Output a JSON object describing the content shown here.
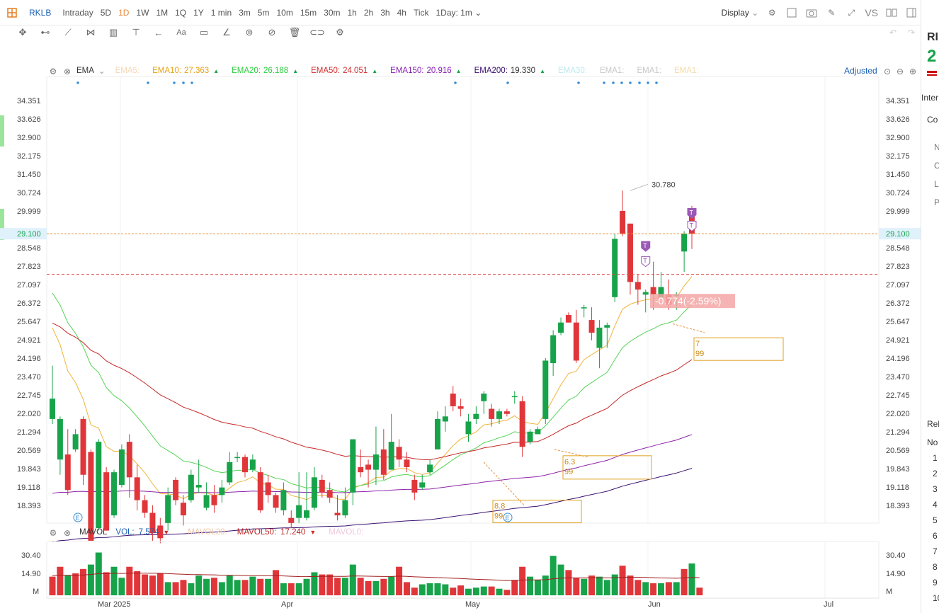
{
  "topbar": {
    "symbol": "RKLB",
    "timeframes": [
      "Intraday",
      "5D",
      "1D",
      "1W",
      "1M",
      "1Q",
      "1Y",
      "1 min",
      "3m",
      "5m",
      "10m",
      "15m",
      "30m",
      "1h",
      "2h",
      "3h",
      "4h",
      "Tick"
    ],
    "active_timeframe": "1D",
    "interval_select": "1Day: 1m",
    "display_label": "Display",
    "vs_label": "VS"
  },
  "ema_legend": {
    "label": "EMA",
    "items": [
      {
        "name": "EMA5:",
        "value": "",
        "color": "#f5d6b8"
      },
      {
        "name": "EMA10:",
        "value": "27.363",
        "color": "#e8a317"
      },
      {
        "name": "EMA20:",
        "value": "26.188",
        "color": "#2ecc40"
      },
      {
        "name": "EMA50:",
        "value": "24.051",
        "color": "#d12b2b"
      },
      {
        "name": "EMA150:",
        "value": "20.916",
        "color": "#8a1fb4"
      },
      {
        "name": "EMA200:",
        "value": "19.330",
        "color": "#3a1070"
      },
      {
        "name": "EMA30:",
        "value": "",
        "color": "#bfe8ee"
      },
      {
        "name": "EMA1:",
        "value": "",
        "color": "#c8c8c8"
      },
      {
        "name": "EMA1:",
        "value": "",
        "color": "#c8c8c8"
      },
      {
        "name": "EMA1:",
        "value": "",
        "color": "#f3dca8"
      }
    ],
    "adjusted_label": "Adjusted"
  },
  "price_axis": {
    "labels": [
      "34.351",
      "33.626",
      "32.900",
      "32.175",
      "31.450",
      "30.724",
      "29.999",
      "29.100",
      "28.548",
      "27.823",
      "27.097",
      "26.372",
      "25.647",
      "24.921",
      "24.196",
      "23.470",
      "22.745",
      "22.020",
      "21.294",
      "20.569",
      "19.843",
      "19.118",
      "18.393"
    ],
    "current_price": "29.100",
    "high_label": "30.780",
    "change_label": "-0.774(-2.59%)"
  },
  "annotations": [
    {
      "line1": "7",
      "line2": "99"
    },
    {
      "line1": "6.3",
      "line2": "99"
    },
    {
      "line1": "8.8",
      "line2": "99"
    }
  ],
  "volume_legend": {
    "label": "MAVOL",
    "vol_name": "VOL:",
    "vol_value": "7.574",
    "mavol20": "MAVOL20:",
    "mavol50_name": "MAVOL50:",
    "mavol50_value": "17.240",
    "mavol0": "MAVOL0:"
  },
  "volume_axis": {
    "labels": [
      "30.40",
      "14.90",
      "M"
    ]
  },
  "date_axis": {
    "labels": [
      "Mar 2025",
      "Apr",
      "May",
      "Jun",
      "Jul"
    ]
  },
  "right_panel": {
    "texts": [
      "RI",
      "2",
      "Inter",
      "Co",
      "N",
      "C",
      "Li",
      "P",
      "Rel",
      "No",
      "1",
      "2",
      "3",
      "4",
      "5",
      "6",
      "7",
      "8",
      "9",
      "10"
    ]
  },
  "candles": [
    [
      21.8,
      22.6,
      23.9,
      21.6
    ],
    [
      20.2,
      21.8,
      21.9,
      19.6
    ],
    [
      20.4,
      19.0,
      21.4,
      18.8
    ],
    [
      20.6,
      21.2,
      21.4,
      20.5
    ],
    [
      21.8,
      19.6,
      21.9,
      19.2
    ],
    [
      20.5,
      17.0,
      20.6,
      17.0
    ],
    [
      17.5,
      20.9,
      21.0,
      17.4
    ],
    [
      19.7,
      17.4,
      19.9,
      17.4
    ],
    [
      18.0,
      19.7,
      19.8,
      17.9
    ],
    [
      19.2,
      20.6,
      20.8,
      19.1
    ],
    [
      20.9,
      19.5,
      21.2,
      18.7
    ],
    [
      19.5,
      18.6,
      20.0,
      18.2
    ],
    [
      18.6,
      18.1,
      18.8,
      17.9
    ],
    [
      18.1,
      17.3,
      18.4,
      17.0
    ],
    [
      17.6,
      17.1,
      17.9,
      16.9
    ],
    [
      17.7,
      18.8,
      19.1,
      17.4
    ],
    [
      19.4,
      18.6,
      19.5,
      18.4
    ],
    [
      18.5,
      18.0,
      18.8,
      17.6
    ],
    [
      18.6,
      19.6,
      19.8,
      18.5
    ],
    [
      19.1,
      19.2,
      20.2,
      18.9
    ],
    [
      18.3,
      18.8,
      19.3,
      18.2
    ],
    [
      18.8,
      18.4,
      19.2,
      18.1
    ],
    [
      18.8,
      19.1,
      19.4,
      18.5
    ],
    [
      19.3,
      20.1,
      20.5,
      19.2
    ],
    [
      20.3,
      20.3,
      20.5,
      20.1
    ],
    [
      20.3,
      19.7,
      20.4,
      19.5
    ],
    [
      19.8,
      20.2,
      20.4,
      19.7
    ],
    [
      19.7,
      18.2,
      19.9,
      18.1
    ],
    [
      19.3,
      18.8,
      19.6,
      18.5
    ],
    [
      18.8,
      18.3,
      18.9,
      18.1
    ],
    [
      18.2,
      19.0,
      19.3,
      18.0
    ],
    [
      17.9,
      17.7,
      18.2,
      17.5
    ],
    [
      17.9,
      18.4,
      19.7,
      17.7
    ],
    [
      17.9,
      18.2,
      19.7,
      17.8
    ],
    [
      18.3,
      19.5,
      19.9,
      18.2
    ],
    [
      19.4,
      18.9,
      19.6,
      18.7
    ],
    [
      19.0,
      18.7,
      19.3,
      18.5
    ],
    [
      18.1,
      18.0,
      18.8,
      17.8
    ],
    [
      18.0,
      18.6,
      19.1,
      17.9
    ],
    [
      18.9,
      21.0,
      21.0,
      18.4
    ],
    [
      19.9,
      19.7,
      20.6,
      19.5
    ],
    [
      20.0,
      19.8,
      20.2,
      19.1
    ],
    [
      19.8,
      20.4,
      21.5,
      19.2
    ],
    [
      20.6,
      19.6,
      21.4,
      19.4
    ],
    [
      19.8,
      20.9,
      22.0,
      19.8
    ],
    [
      20.7,
      20.2,
      21.0,
      19.9
    ],
    [
      20.2,
      19.9,
      20.5,
      19.7
    ],
    [
      19.4,
      18.9,
      19.6,
      18.6
    ],
    [
      19.1,
      19.3,
      19.6,
      19.0
    ],
    [
      19.7,
      20.0,
      20.2,
      19.6
    ],
    [
      20.6,
      21.8,
      22.1,
      20.6
    ],
    [
      21.7,
      21.9,
      22.3,
      21.3
    ],
    [
      22.8,
      22.3,
      23.1,
      22.1
    ],
    [
      22.3,
      22.2,
      22.6,
      21.9
    ],
    [
      21.2,
      21.7,
      22.0,
      20.9
    ],
    [
      21.8,
      22.0,
      22.3,
      21.6
    ],
    [
      22.5,
      22.8,
      22.9,
      22.0
    ],
    [
      22.2,
      21.8,
      22.4,
      21.5
    ],
    [
      21.8,
      22.1,
      22.2,
      21.6
    ],
    [
      22.1,
      22.0,
      22.2,
      21.9
    ],
    [
      22.7,
      22.7,
      22.9,
      22.4
    ],
    [
      22.5,
      20.7,
      22.7,
      20.3
    ],
    [
      20.9,
      21.3,
      21.4,
      20.8
    ],
    [
      21.2,
      21.4,
      21.5,
      21.2
    ],
    [
      21.8,
      24.1,
      24.2,
      21.6
    ],
    [
      24.0,
      25.1,
      25.3,
      23.5
    ],
    [
      25.2,
      25.6,
      25.8,
      25.1
    ],
    [
      25.9,
      25.6,
      26.0,
      25.6
    ],
    [
      25.6,
      24.1,
      26.1,
      24.0
    ],
    [
      26.2,
      26.2,
      26.3,
      25.8
    ],
    [
      25.7,
      25.2,
      26.2,
      24.9
    ],
    [
      24.6,
      25.4,
      25.7,
      23.8
    ],
    [
      25.4,
      25.5,
      25.6,
      24.6
    ],
    [
      26.6,
      28.9,
      29.1,
      26.4
    ],
    [
      30.0,
      29.1,
      30.8,
      29.0
    ],
    [
      29.5,
      27.2,
      29.5,
      26.7
    ],
    [
      27.2,
      26.9,
      27.5,
      26.3
    ],
    [
      26.7,
      26.8,
      26.9,
      26.0
    ],
    [
      27.0,
      26.7,
      28.0,
      26.1
    ],
    [
      26.6,
      27.0,
      27.6,
      26.6
    ],
    [
      26.7,
      26.3,
      27.3,
      26.1
    ],
    [
      26.7,
      26.7,
      26.8,
      26.1
    ],
    [
      28.4,
      29.1,
      29.2,
      27.6
    ],
    [
      30.0,
      29.1,
      30.2,
      28.5
    ]
  ],
  "volumes": [
    17,
    26,
    18,
    20,
    24,
    28,
    39,
    21,
    26,
    16,
    26,
    22,
    19,
    18,
    20,
    12,
    12,
    14,
    11,
    18,
    15,
    16,
    12,
    18,
    14,
    14,
    17,
    15,
    15,
    23,
    11,
    11,
    11,
    15,
    21,
    19,
    19,
    16,
    16,
    28,
    16,
    13,
    13,
    15,
    17,
    26,
    12,
    7,
    10,
    11,
    11,
    10,
    7,
    9,
    6,
    7,
    8,
    8,
    6,
    5,
    14,
    26,
    17,
    14,
    18,
    36,
    28,
    23,
    16,
    15,
    18,
    17,
    14,
    19,
    27,
    18,
    14,
    12,
    11,
    11,
    12,
    12,
    24,
    29,
    7
  ],
  "volume_colors_up": [
    0,
    0,
    1,
    0,
    0,
    1,
    1,
    0,
    1,
    1,
    0,
    0,
    0,
    0,
    0,
    1,
    0,
    0,
    1,
    1,
    1,
    0,
    1,
    1,
    1,
    0,
    1,
    0,
    1,
    0,
    1,
    0,
    1,
    1,
    1,
    0,
    0,
    0,
    1,
    1,
    0,
    0,
    1,
    0,
    1,
    0,
    0,
    0,
    1,
    1,
    1,
    1,
    0,
    0,
    1,
    1,
    1,
    0,
    1,
    0,
    0,
    0,
    1,
    1,
    1,
    1,
    1,
    0,
    0,
    1,
    0,
    1,
    1,
    1,
    0,
    0,
    0,
    1,
    0,
    1,
    0,
    1,
    0,
    1,
    0
  ]
}
